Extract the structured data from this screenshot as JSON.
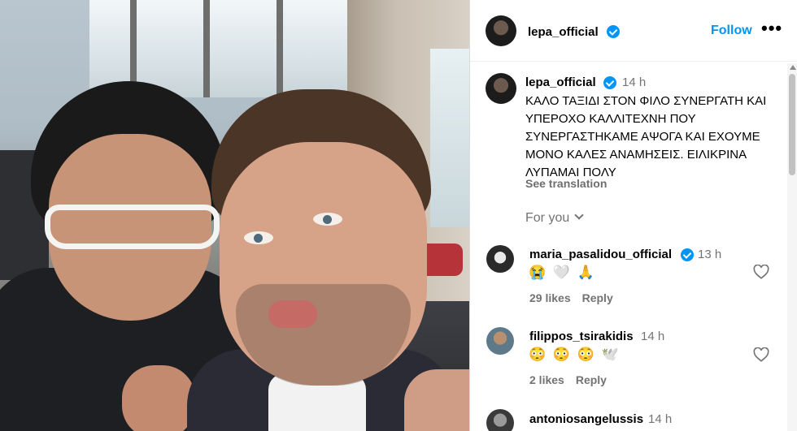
{
  "post": {
    "author": "lepa_official",
    "follow_label": "Follow",
    "more_label": "•••"
  },
  "caption": {
    "author": "lepa_official",
    "time": "14 h",
    "text": "ΚΑΛΟ ΤΑΞΙΔΙ ΣΤΟΝ ΦΙΛΟ ΣΥΝΕΡΓΑΤΗ ΚΑΙ ΥΠΕΡΟΧΟ ΚΑΛΛΙΤΕΧΝΗ ΠΟΥ ΣΥΝΕΡΓΑΣΤΗΚΑΜΕ ΑΨΟΓΑ ΚΑΙ ΕΧΟΥΜΕ ΜΟΝΟ ΚΑΛΕΣ ΑΝΑΜΗΣΕΙΣ. ΕΙΛΙΚΡΙΝΑ ΛΥΠΑΜΑΙ ΠΟΛΥ",
    "see_translation": "See translation",
    "for_you": "For you"
  },
  "comments": [
    {
      "username": "maria_pasalidou_official",
      "verified": true,
      "time": "13 h",
      "emojis": "😭 🤍 🙏",
      "likes": "29 likes",
      "reply": "Reply"
    },
    {
      "username": "filippos_tsirakidis",
      "verified": false,
      "time": "14 h",
      "emojis": "😳 😳 😳 🕊️",
      "likes": "2 likes",
      "reply": "Reply"
    },
    {
      "username": "antoniosangelussis",
      "verified": false,
      "time": "14 h"
    }
  ],
  "icons": {
    "header_avatar": "avatar-lepa",
    "verified": "verified-badge-icon",
    "heart": "heart-outline-icon",
    "chevron": "chevron-down-icon"
  },
  "colors": {
    "accent": "#0095f6",
    "secondary_text": "#737373"
  }
}
